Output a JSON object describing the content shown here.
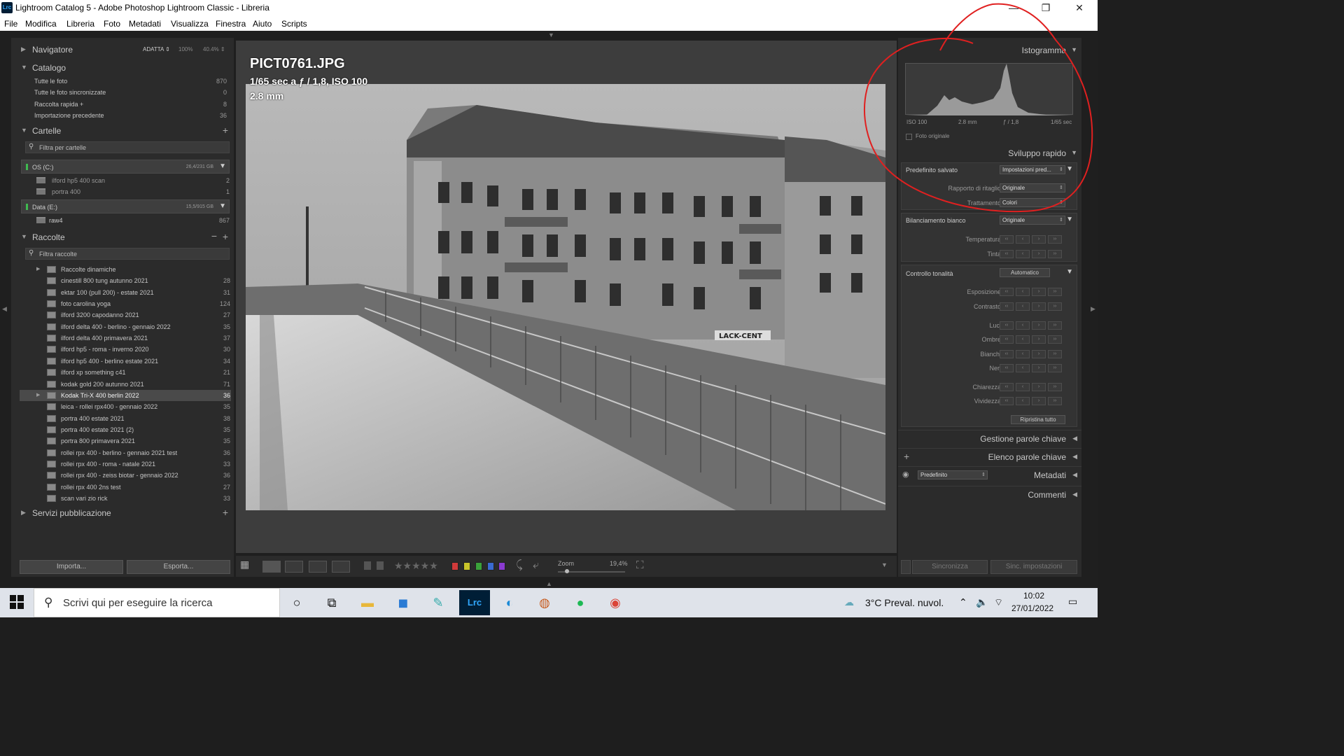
{
  "window": {
    "app_icon": "Lrc",
    "title": "Lightroom Catalog 5 - Adobe Photoshop Lightroom Classic - Libreria",
    "minimize": "—",
    "restore": "❐",
    "close": "✕"
  },
  "menu": [
    "File",
    "Modifica",
    "Libreria",
    "Foto",
    "Metadati",
    "Visualizza",
    "Finestra",
    "Aiuto",
    "Scripts"
  ],
  "navigator": {
    "title": "Navigatore",
    "zoom_options": [
      "ADATTA ⇕",
      "100%",
      "40.4% ⇕"
    ]
  },
  "catalog": {
    "title": "Catalogo",
    "rows": [
      {
        "label": "Tutte le foto",
        "count": "870"
      },
      {
        "label": "Tutte le foto sincronizzate",
        "count": "0"
      },
      {
        "label": "Raccolta rapida +",
        "count": "8"
      },
      {
        "label": "Importazione precedente",
        "count": "36"
      }
    ]
  },
  "folders": {
    "title": "Cartelle",
    "filter_placeholder": "Filtra per cartelle",
    "volumes": [
      {
        "name": "OS (C:)",
        "size": "26,4/231 GB",
        "folders": [
          {
            "name": "ilford hp5 400 scan",
            "count": "2"
          },
          {
            "name": "portra 400",
            "count": "1"
          }
        ]
      },
      {
        "name": "Data (E:)",
        "size": "15,5/915 GB",
        "folders": [
          {
            "name": "raw4",
            "count": "867"
          }
        ]
      }
    ]
  },
  "collections": {
    "title": "Raccolte",
    "filter_placeholder": "Filtra raccolte",
    "items": [
      {
        "name": "Raccolte dinamiche",
        "count": ""
      },
      {
        "name": "cinestill 800 tung autunno 2021",
        "count": "28"
      },
      {
        "name": "ektar 100 (pull 200) - estate 2021",
        "count": "31"
      },
      {
        "name": "foto carolina yoga",
        "count": "124"
      },
      {
        "name": "ilford 3200 capodanno 2021",
        "count": "27"
      },
      {
        "name": "ilford delta 400 - berlino - gennaio 2022",
        "count": "35"
      },
      {
        "name": "ilford delta 400 primavera 2021",
        "count": "37"
      },
      {
        "name": "ilford hp5 - roma - inverno 2020",
        "count": "30"
      },
      {
        "name": "ilford hp5 400 - berlino estate 2021",
        "count": "34"
      },
      {
        "name": "ilford xp something c41",
        "count": "21"
      },
      {
        "name": "kodak gold 200 autunno 2021",
        "count": "71"
      },
      {
        "name": "Kodak Tri-X 400 berlin 2022",
        "count": "36"
      },
      {
        "name": "leica - rollei rpx400 - gennaio 2022",
        "count": "35"
      },
      {
        "name": "portra 400 estate 2021",
        "count": "38"
      },
      {
        "name": "portra 400 estate 2021 (2)",
        "count": "35"
      },
      {
        "name": "portra 800 primavera 2021",
        "count": "35"
      },
      {
        "name": "rollei rpx 400 - berlino - gennaio 2021 test",
        "count": "36"
      },
      {
        "name": "rollei rpx 400 - roma - natale 2021",
        "count": "33"
      },
      {
        "name": "rollei rpx 400 - zeiss biotar - gennaio 2022",
        "count": "36"
      },
      {
        "name": "rollei rpx 400 2ns test",
        "count": "27"
      },
      {
        "name": "scan vari zio rick",
        "count": "33"
      }
    ],
    "selected_index": 11
  },
  "publish": {
    "title": "Servizi pubblicazione"
  },
  "left_buttons": {
    "import": "Importa...",
    "export": "Esporta..."
  },
  "photo": {
    "filename": "PICT0761.JPG",
    "exposure": "1/65 sec a ƒ / 1,8, ISO 100",
    "focal": "2.8 mm",
    "sign_text": "LACK-CENT"
  },
  "toolbar": {
    "stars": "★★★★★",
    "zoom_label": "Zoom",
    "zoom_value": "19,4%",
    "zoom_level": 0.1
  },
  "histogram": {
    "title": "Istogramma",
    "iso": "ISO 100",
    "focal": "2.8 mm",
    "aperture": "ƒ / 1,8",
    "shutter": "1/65 sec",
    "original_photo": "Foto originale"
  },
  "quick_develop": {
    "title": "Sviluppo rapido",
    "saved_preset_label": "Predefinito salvato",
    "saved_preset_value": "Impostazioni pred...",
    "crop_ratio_label": "Rapporto di ritaglio",
    "crop_ratio_value": "Originale",
    "treatment_label": "Trattamento",
    "treatment_value": "Colori",
    "wb_label": "Bilanciamento bianco",
    "wb_value": "Originale",
    "temperature": "Temperatura",
    "tint": "Tinta",
    "tone_label": "Controllo tonalità",
    "auto_button": "Automatico",
    "exposure": "Esposizione",
    "contrast": "Contrasto",
    "highlights": "Luci",
    "shadows": "Ombre",
    "whites": "Bianchi",
    "blacks": "Neri",
    "clarity": "Chiarezza",
    "vibrance": "Vividezza",
    "reset_all": "Ripristina tutto",
    "step_glyphs": [
      "‹‹",
      "‹",
      "›",
      "››"
    ]
  },
  "right_panels": {
    "keywording": "Gestione parole chiave",
    "keyword_list": "Elenco parole chiave",
    "metadata": "Metadati",
    "metadata_preset": "Predefinito",
    "comments": "Commenti"
  },
  "right_buttons": {
    "sync": "Sincronizza",
    "sync_settings": "Sinc. impostazioni"
  },
  "taskbar": {
    "search_placeholder": "Scrivi qui per eseguire la ricerca",
    "weather": "3°C  Preval. nuvol.",
    "time": "10:02",
    "date": "27/01/2022"
  },
  "colors": {
    "label_red": "#d03a3a",
    "label_yellow": "#c9c42a",
    "label_green": "#3aa23a",
    "label_blue": "#3a6ad0",
    "label_purple": "#8a3ad0",
    "annotation_red": "#e02020"
  }
}
